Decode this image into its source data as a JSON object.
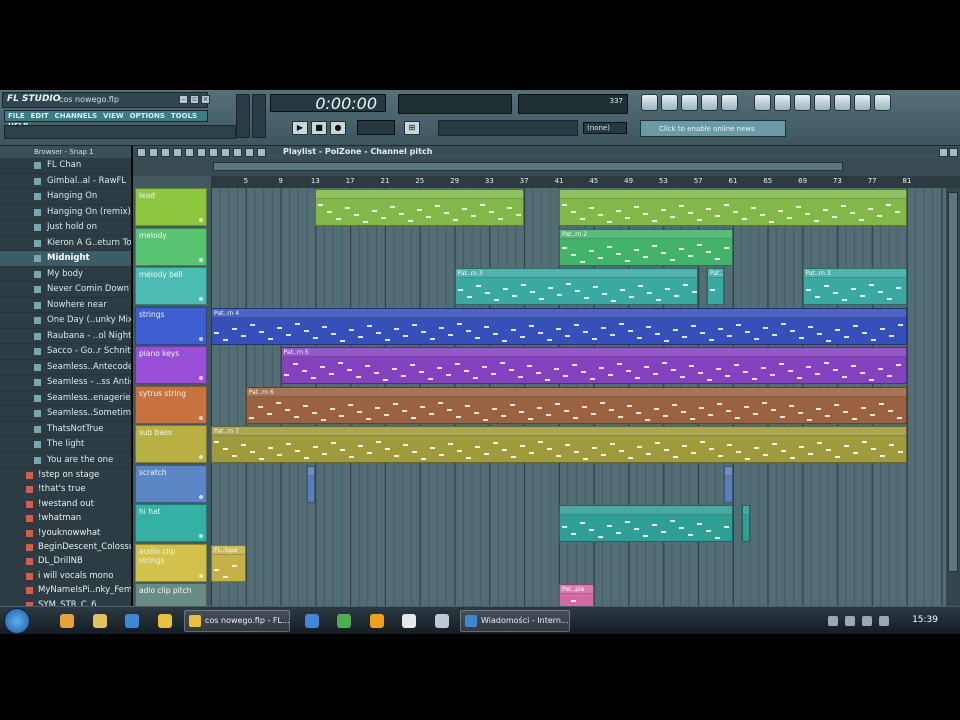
{
  "app": {
    "logo": "FL STUDIO",
    "project": "cos nowego.flp",
    "menus": [
      "FILE",
      "EDIT",
      "CHANNELS",
      "VIEW",
      "OPTIONS",
      "TOOLS",
      "HELP"
    ],
    "time": "0:00:00",
    "cpu_value": "337",
    "select_value": "(none)",
    "news": "Click to enable online news"
  },
  "browser": {
    "header": "Browser - Snap 1",
    "items": [
      "FL Chan",
      "Gimbal..al - RawFL",
      "Hanging On",
      "Hanging On (remix)",
      "Just hold on",
      "Kieron A G..eturn To",
      "Midnight",
      "My body",
      "Never Comin Down",
      "Nowhere near",
      "One Day (..unky Mix)",
      "Raubana - ..ol Nights",
      "Sacco - Go..r Schnitt",
      "Seamless..Antecoder",
      "Seamless - ..ss Antics",
      "Seamless..enagerie",
      "Seamless..Sometime",
      "ThatsNotTrue",
      "The light",
      "You are the one"
    ],
    "selected_index": 6,
    "samples": [
      "!step on stage",
      "!that's true",
      "!westand out",
      "!whatman",
      "!youknowwhat",
      "BeginDescent_Colossus",
      "DL_DrillNB",
      "i will vocals mono",
      "MyNameIsPi..nky_Female",
      "SYM_STR_C_6"
    ]
  },
  "playlist": {
    "title": "Playlist - PolZone - Channel pitch",
    "ruler": [
      "5",
      "9",
      "13",
      "17",
      "21",
      "25",
      "29",
      "33",
      "37",
      "41",
      "45",
      "49",
      "53",
      "57",
      "61",
      "65",
      "69",
      "73",
      "77",
      "81"
    ],
    "tracks": [
      {
        "name": "lead",
        "color": "#8dc63f"
      },
      {
        "name": "melody",
        "color": "#58c472"
      },
      {
        "name": "melody bell",
        "color": "#4cbcb2"
      },
      {
        "name": "strings",
        "color": "#3f5fd0"
      },
      {
        "name": "piano keys",
        "color": "#9a4fd8"
      },
      {
        "name": "sytrus string",
        "color": "#c8733f"
      },
      {
        "name": "sub bass",
        "color": "#b9b043"
      },
      {
        "name": "scratch",
        "color": "#5c85c4"
      },
      {
        "name": "hi hat",
        "color": "#34b0a4"
      },
      {
        "name": "audio clip strings",
        "color": "#d2c14a"
      },
      {
        "name": "adio clip pitch",
        "color": "#6a8c86"
      }
    ],
    "clips": [
      {
        "track": 0,
        "start": 13,
        "end": 37,
        "label": "",
        "color": "#82b84a"
      },
      {
        "track": 0,
        "start": 41,
        "end": 81,
        "label": "",
        "color": "#82b84a"
      },
      {
        "track": 1,
        "start": 41,
        "end": 61,
        "label": "Pat..rn 2",
        "color": "#43b36a"
      },
      {
        "track": 2,
        "start": 29,
        "end": 57,
        "label": "Pat..rn 3",
        "color": "#3aa9a2"
      },
      {
        "track": 2,
        "start": 58,
        "end": 60,
        "label": "Pat..rn 3",
        "color": "#3aa9a2"
      },
      {
        "track": 2,
        "start": 69,
        "end": 81,
        "label": "Pat..rn 3",
        "color": "#3aa9a2"
      },
      {
        "track": 3,
        "start": 1,
        "end": 81,
        "label": "Pat..rn 4",
        "color": "#3550b9"
      },
      {
        "track": 4,
        "start": 9,
        "end": 81,
        "label": "Pat..rn 5",
        "color": "#8442bf"
      },
      {
        "track": 5,
        "start": 5,
        "end": 81,
        "label": "Pat..rn 6",
        "color": "#9a6240"
      },
      {
        "track": 6,
        "start": 1,
        "end": 81,
        "label": "Pat..rn 7",
        "color": "#9f9a3c"
      },
      {
        "track": 7,
        "start": 12,
        "end": 13,
        "label": "",
        "color": "#5a7fb8"
      },
      {
        "track": 7,
        "start": 60,
        "end": 61,
        "label": "",
        "color": "#5a7fb8"
      },
      {
        "track": 8,
        "start": 41,
        "end": 61,
        "label": "",
        "color": "#2f9e94"
      },
      {
        "track": 8,
        "start": 62,
        "end": 63,
        "label": "",
        "color": "#2f9e94"
      },
      {
        "track": 9,
        "start": 1,
        "end": 5,
        "label": "FL..lope",
        "color": "#c5b148"
      },
      {
        "track": 10,
        "start": 41,
        "end": 45,
        "label": "Pat..ple",
        "color": "#d56aa6"
      }
    ]
  },
  "taskbar": {
    "tasks": [
      "cos nowego.flp - FL...",
      "Wiadomości - Intern..."
    ],
    "clock": "15:39"
  }
}
